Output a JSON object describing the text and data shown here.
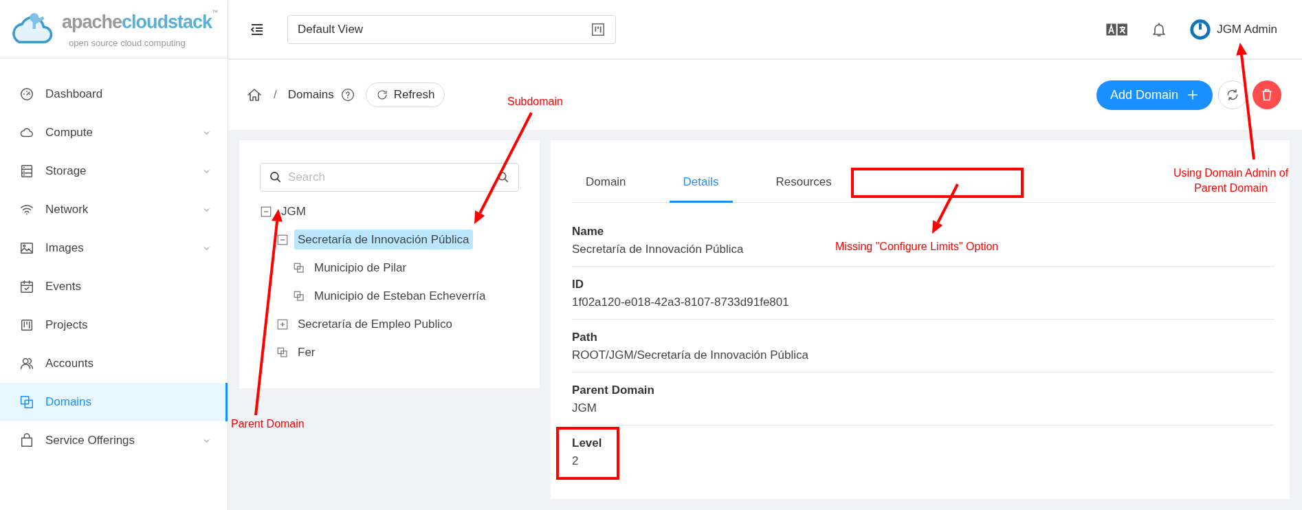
{
  "logo": {
    "word_1": "apache",
    "word_2": "cloudstack",
    "tm": "™",
    "tagline": "open source cloud computing"
  },
  "sidebar": {
    "items": [
      {
        "label": "Dashboard",
        "has_submenu": false,
        "selected": false
      },
      {
        "label": "Compute",
        "has_submenu": true,
        "selected": false
      },
      {
        "label": "Storage",
        "has_submenu": true,
        "selected": false
      },
      {
        "label": "Network",
        "has_submenu": true,
        "selected": false
      },
      {
        "label": "Images",
        "has_submenu": true,
        "selected": false
      },
      {
        "label": "Events",
        "has_submenu": false,
        "selected": false
      },
      {
        "label": "Projects",
        "has_submenu": false,
        "selected": false
      },
      {
        "label": "Accounts",
        "has_submenu": false,
        "selected": false
      },
      {
        "label": "Domains",
        "has_submenu": false,
        "selected": true
      },
      {
        "label": "Service Offerings",
        "has_submenu": true,
        "selected": false
      }
    ]
  },
  "header": {
    "view_select": "Default View",
    "user": "JGM Admin"
  },
  "breadcrumb": {
    "separator": "/",
    "page": "Domains",
    "refresh_button": "Refresh"
  },
  "actions": {
    "add_button": "Add Domain"
  },
  "tree": {
    "search": {
      "placeholder": "Search"
    },
    "nodes": [
      {
        "label": "JGM",
        "kind": "branch",
        "expanded": true,
        "selected": false,
        "children": [
          {
            "label": "Secretaría de Innovación Pública",
            "kind": "branch",
            "expanded": true,
            "selected": true,
            "children": [
              {
                "label": "Municipio de Pilar",
                "kind": "leaf",
                "selected": false
              },
              {
                "label": "Municipio de Esteban Echeverría",
                "kind": "leaf",
                "selected": false
              }
            ]
          },
          {
            "label": "Secretaría de Empleo Publico",
            "kind": "branch",
            "expanded": false,
            "selected": false
          },
          {
            "label": "Fer",
            "kind": "leaf",
            "selected": false
          }
        ]
      }
    ]
  },
  "tabs": [
    {
      "label": "Domain",
      "selected": false
    },
    {
      "label": "Details",
      "selected": true
    },
    {
      "label": "Resources",
      "selected": false
    }
  ],
  "details": [
    {
      "label": "Name",
      "value": "Secretaría de Innovación Pública"
    },
    {
      "label": "ID",
      "value": "1f02a120-e018-42a3-8107-8733d91fe801"
    },
    {
      "label": "Path",
      "value": "ROOT/JGM/Secretaría de Innovación Pública"
    },
    {
      "label": "Parent Domain",
      "value": "JGM"
    },
    {
      "label": "Level",
      "value": "2"
    }
  ],
  "annotations": [
    {
      "kind": "note",
      "text": "Subdomain"
    },
    {
      "kind": "note",
      "text": "Parent Domain"
    },
    {
      "kind": "note",
      "text": "Missing \"Configure Limits\" Option"
    },
    {
      "kind": "note",
      "text": "Using Domain Admin of Parent Domain"
    }
  ]
}
